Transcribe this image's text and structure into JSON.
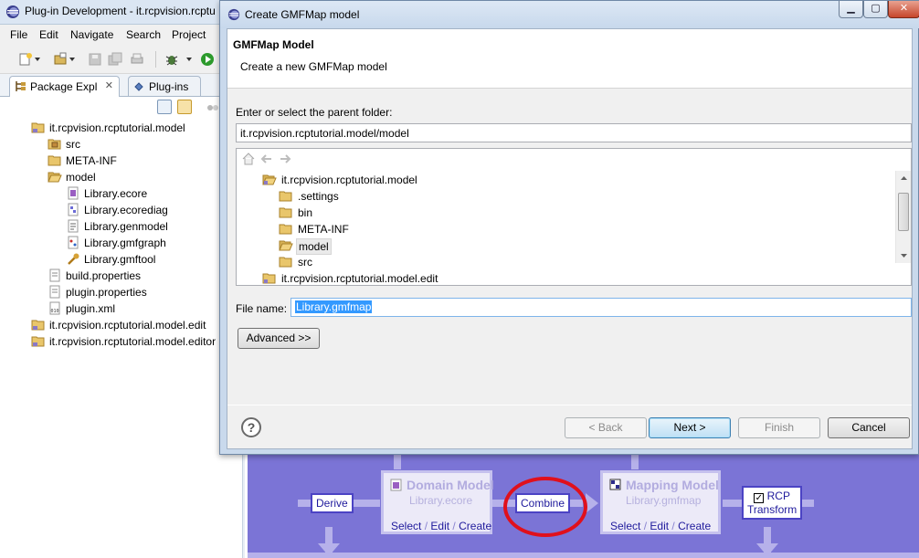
{
  "background_window": {
    "title": "Plug-in Development - it.rcpvision.rcptu",
    "menu": [
      "File",
      "Edit",
      "Navigate",
      "Search",
      "Project"
    ],
    "tabs": [
      {
        "label": "Package Expl",
        "active": true
      },
      {
        "label": "Plug-ins",
        "active": false
      }
    ],
    "tree": [
      {
        "label": "it.rcpvision.rcptutorial.model",
        "icon": "project-folder-icon",
        "level": 0
      },
      {
        "label": "src",
        "icon": "package-folder-icon",
        "level": 1
      },
      {
        "label": "META-INF",
        "icon": "folder-icon",
        "level": 1
      },
      {
        "label": "model",
        "icon": "folder-open-icon",
        "level": 1
      },
      {
        "label": "Library.ecore",
        "icon": "ecore-file-icon",
        "level": 2
      },
      {
        "label": "Library.ecorediag",
        "icon": "ecorediag-file-icon",
        "level": 2
      },
      {
        "label": "Library.genmodel",
        "icon": "genmodel-file-icon",
        "level": 2
      },
      {
        "label": "Library.gmfgraph",
        "icon": "gmfgraph-file-icon",
        "level": 2
      },
      {
        "label": "Library.gmftool",
        "icon": "gmftool-file-icon",
        "level": 2,
        "selected": true
      },
      {
        "label": "build.properties",
        "icon": "properties-file-icon",
        "level": 1
      },
      {
        "label": "plugin.properties",
        "icon": "properties-file-icon",
        "level": 1
      },
      {
        "label": "plugin.xml",
        "icon": "xml-file-icon",
        "level": 1
      },
      {
        "label": "it.rcpvision.rcptutorial.model.edit",
        "icon": "project-folder-icon",
        "level": 0
      },
      {
        "label": "it.rcpvision.rcptutorial.model.editor",
        "icon": "project-folder-icon",
        "level": 0
      }
    ]
  },
  "dialog": {
    "title": "Create GMFMap model",
    "header_title": "GMFMap Model",
    "header_description": "Create a new GMFMap model",
    "parent_folder_label": "Enter or select the parent folder:",
    "parent_folder_value": "it.rcpvision.rcptutorial.model/model",
    "folder_tree": [
      {
        "label": "it.rcpvision.rcptutorial.model",
        "icon": "project-folder-icon",
        "level": 0
      },
      {
        "label": ".settings",
        "icon": "folder-icon",
        "level": 1
      },
      {
        "label": "bin",
        "icon": "folder-icon",
        "level": 1
      },
      {
        "label": "META-INF",
        "icon": "folder-icon",
        "level": 1
      },
      {
        "label": "model",
        "icon": "folder-open-icon",
        "level": 1,
        "selected": true
      },
      {
        "label": "src",
        "icon": "folder-icon",
        "level": 1
      },
      {
        "label": "it.rcpvision.rcptutorial.model.edit",
        "icon": "project-folder-icon",
        "level": 0
      }
    ],
    "file_name_label": "File name:",
    "file_name_value": "Library.gmfmap",
    "advanced_label": "Advanced >>",
    "buttons": {
      "back": "< Back",
      "next": "Next >",
      "finish": "Finish",
      "cancel": "Cancel"
    }
  },
  "diagram": {
    "derive_label": "Derive",
    "combine_label": "Combine",
    "domain_model": {
      "title": "Domain Model",
      "file": "Library.ecore"
    },
    "mapping_model": {
      "title": "Mapping Model",
      "file": "Library.gmfmap"
    },
    "link_select": "Select",
    "link_edit": "Edit",
    "link_create": "Create",
    "link_separator": "/",
    "rcp_label": "RCP",
    "transform_label": "Transform",
    "highlight_color": "#e0101c",
    "background_color": "#7b74d6"
  }
}
